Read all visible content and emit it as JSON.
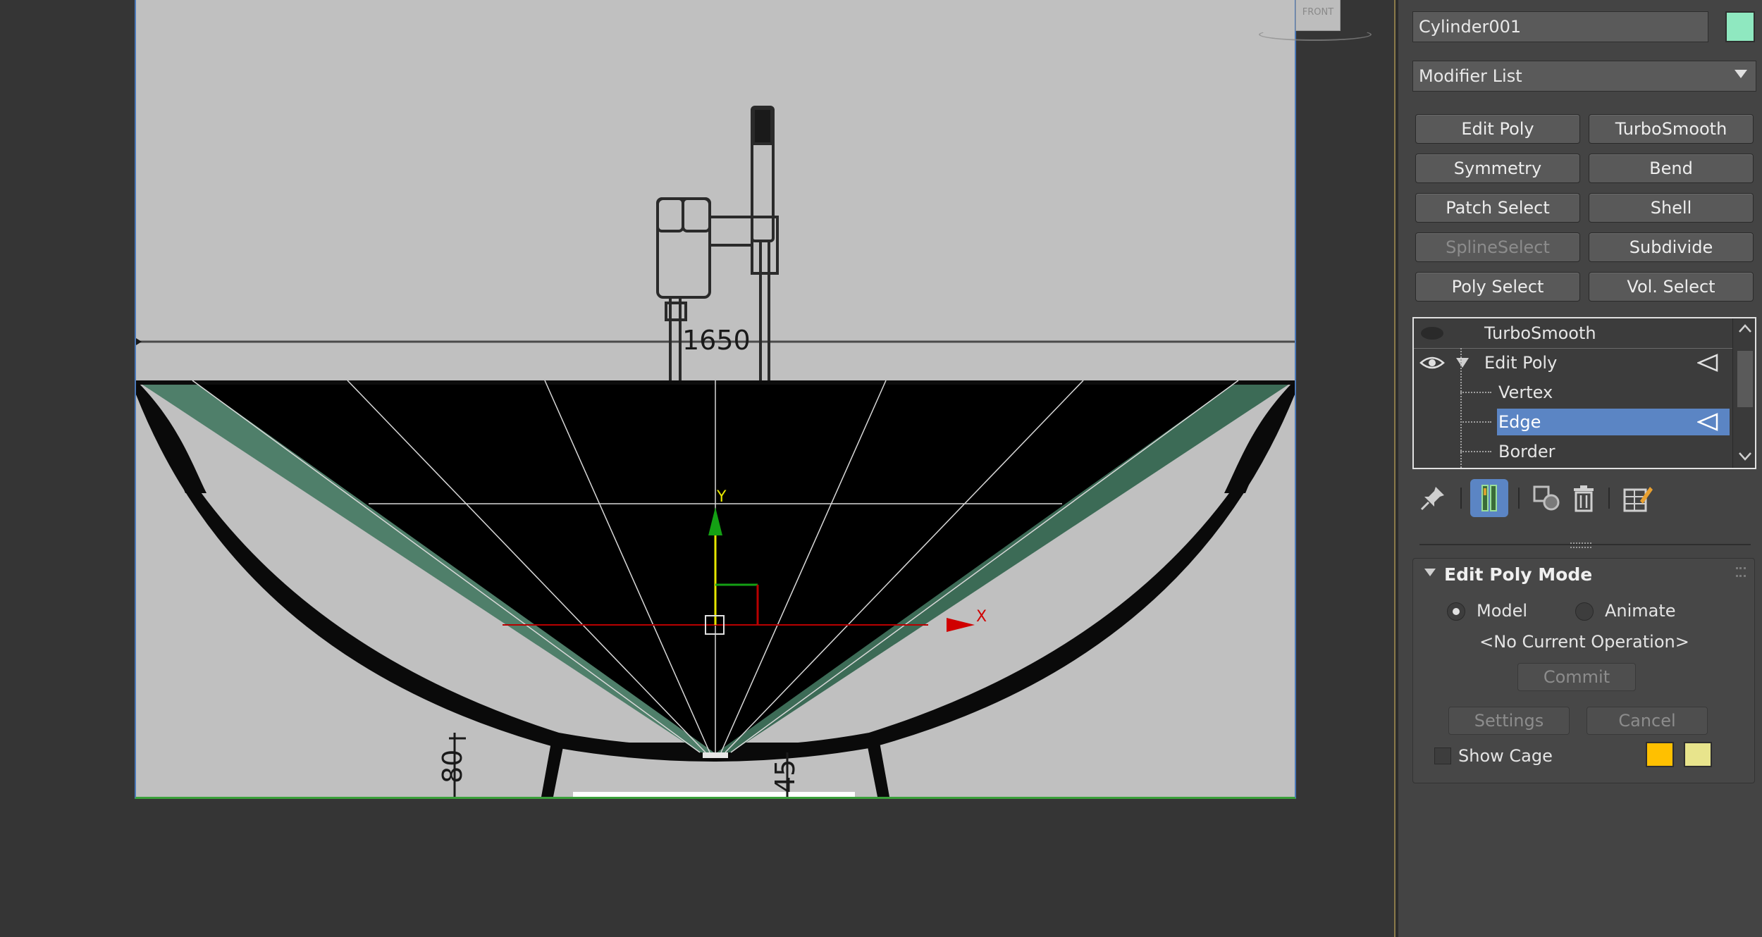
{
  "viewport": {
    "viewcube_label": "FRONT",
    "drawing_dimensions": {
      "height_mark": "1650",
      "dim_left": "80",
      "dim_center": "45"
    },
    "axis_labels": {
      "y": "Y",
      "x": "X"
    }
  },
  "command_panel": {
    "object_name": "Cylinder001",
    "object_color": "#8fe8c0",
    "modifier_list_label": "Modifier List",
    "modifier_buttons": [
      {
        "label": "Edit Poly",
        "enabled": true
      },
      {
        "label": "TurboSmooth",
        "enabled": true
      },
      {
        "label": "Symmetry",
        "enabled": true
      },
      {
        "label": "Bend",
        "enabled": true
      },
      {
        "label": "Patch Select",
        "enabled": true
      },
      {
        "label": "Shell",
        "enabled": true
      },
      {
        "label": "SplineSelect",
        "enabled": false
      },
      {
        "label": "Subdivide",
        "enabled": true
      },
      {
        "label": "Poly Select",
        "enabled": true
      },
      {
        "label": "Vol. Select",
        "enabled": true
      }
    ],
    "stack": {
      "items": [
        {
          "label": "TurboSmooth",
          "visible": false
        },
        {
          "label": "Edit Poly",
          "visible": true,
          "expanded": true
        },
        {
          "label": "Vertex"
        },
        {
          "label": "Edge",
          "selected": true
        },
        {
          "label": "Border"
        }
      ]
    },
    "stack_toolbar": [
      "pin-stack-icon",
      "show-end-result-icon",
      "make-unique-icon",
      "remove-modifier-icon",
      "configure-modifier-sets-icon"
    ],
    "rollout": {
      "title": "Edit Poly Mode",
      "mode_options": [
        {
          "label": "Model",
          "selected": true
        },
        {
          "label": "Animate",
          "selected": false
        }
      ],
      "current_operation": "<No Current Operation>",
      "commit_label": "Commit",
      "settings_label": "Settings",
      "cancel_label": "Cancel",
      "show_cage_label": "Show Cage",
      "show_cage_checked": false,
      "cage_colors": [
        "#ffc000",
        "#e8e48c"
      ]
    }
  }
}
